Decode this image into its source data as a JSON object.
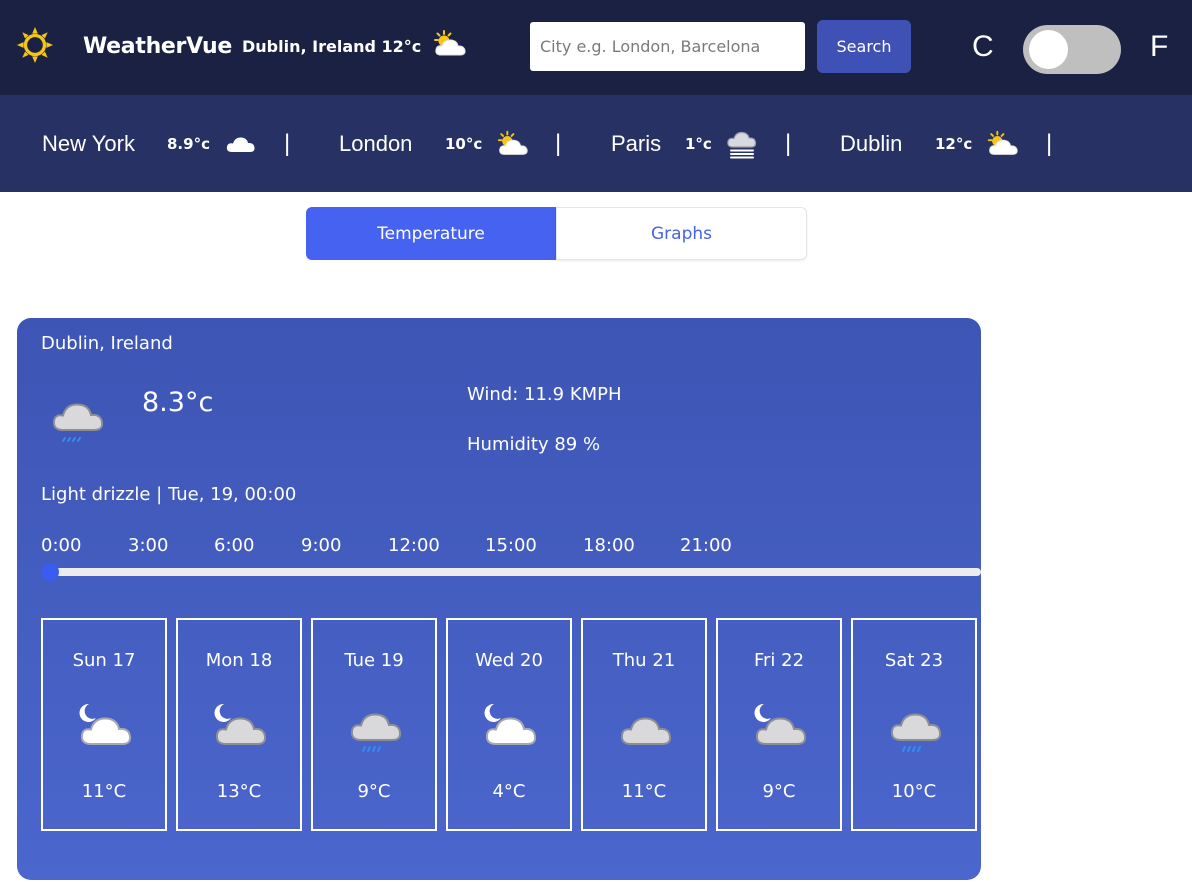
{
  "app": {
    "brand": "WeatherVue",
    "current_summary": "Dublin, Ireland 12°c",
    "current_icon": "sun-cloud-icon"
  },
  "search": {
    "placeholder": "City e.g. London, Barcelona",
    "value": "",
    "button_label": "Search"
  },
  "units": {
    "left": "C",
    "right": "F",
    "selected": "C"
  },
  "ticker": [
    {
      "city": "New York",
      "temp": "8.9°c",
      "icon": "cloud-icon"
    },
    {
      "city": "London",
      "temp": "10°c",
      "icon": "sun-cloud-icon"
    },
    {
      "city": "Paris",
      "temp": "1°c",
      "icon": "fog-icon"
    },
    {
      "city": "Dublin",
      "temp": "12°c",
      "icon": "sun-cloud-icon"
    }
  ],
  "separator": "|",
  "tabs": [
    {
      "label": "Temperature",
      "active": true
    },
    {
      "label": "Graphs",
      "active": false
    }
  ],
  "current": {
    "location": "Dublin, Ireland",
    "temp": "8.3°c",
    "wind": "Wind: 11.9 KMPH",
    "humidity": "Humidity 89 %",
    "condition": "Light drizzle | Tue, 19, 00:00",
    "icon": "drizzle-cloud-icon"
  },
  "times": [
    "0:00",
    "3:00",
    "6:00",
    "9:00",
    "12:00",
    "15:00",
    "18:00",
    "21:00"
  ],
  "slider_value_fraction": 0,
  "forecast": [
    {
      "day": "Sun 17",
      "temp": "11°C",
      "icon": "moon-cloud-icon"
    },
    {
      "day": "Mon 18",
      "temp": "13°C",
      "icon": "moon-cloud-icon"
    },
    {
      "day": "Tue 19",
      "temp": "9°C",
      "icon": "drizzle-cloud-icon"
    },
    {
      "day": "Wed 20",
      "temp": "4°C",
      "icon": "moon-cloud-icon"
    },
    {
      "day": "Thu 21",
      "temp": "11°C",
      "icon": "cloud-icon"
    },
    {
      "day": "Fri 22",
      "temp": "9°C",
      "icon": "moon-cloud-icon"
    },
    {
      "day": "Sat 23",
      "temp": "10°C",
      "icon": "drizzle-cloud-icon"
    }
  ],
  "colors": {
    "nav_bg": "#1b2142",
    "ticker_bg": "#273163",
    "accent": "#4562f0",
    "card_bg": "#4359bf",
    "sun": "#f5c518"
  }
}
